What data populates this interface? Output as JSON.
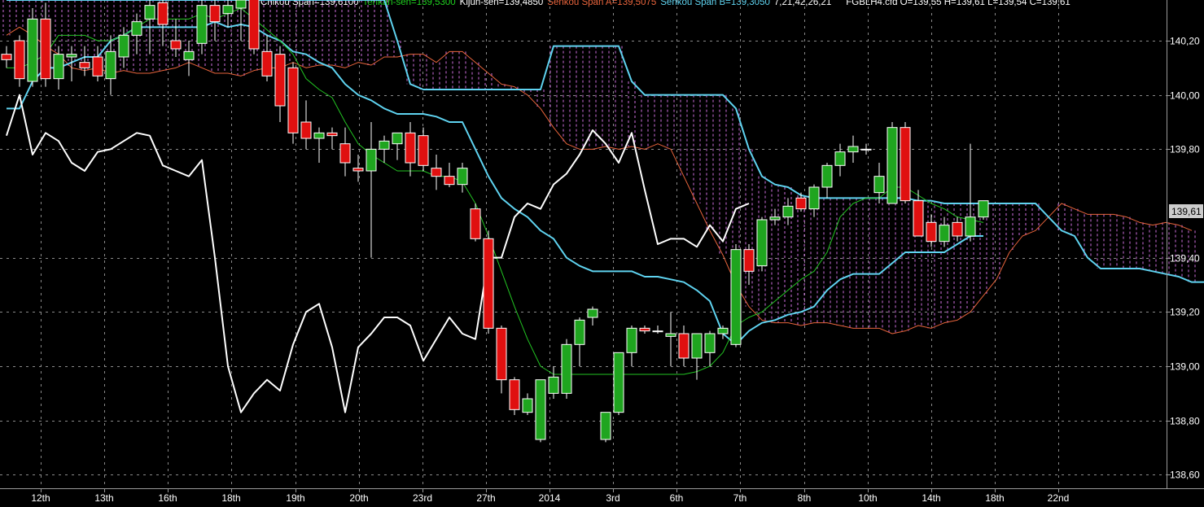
{
  "legend": {
    "chikou": "Chikou Span=139,6100",
    "tenkan": "Tenkan-sen=139,5300",
    "kijun": "Kijun-sen=139,4850",
    "senkou_a": "Senkou Span A=139,5075",
    "senkou_b": "Senkou Span B=139,3050",
    "params": "7,21,42,26,21",
    "instrument": "FGBLH4.cfd O=139,55 H=139,61 L=139,54 C=139,61"
  },
  "colors": {
    "background": "#000000",
    "grid": "#8a8a8a",
    "bull": "#1fa51f",
    "bear": "#e01010",
    "chikou": "#ffffff",
    "tenkan": "#22c422",
    "kijun": "#ffffff",
    "senkou_a": "#e8643c",
    "senkou_b": "#5fd3f0",
    "cloud_hatch": "#d070e0",
    "price_tag_bg": "#cccccc"
  },
  "price_tag": "139,61",
  "chart_data": {
    "type": "candlestick",
    "ylim": [
      138.55,
      140.35
    ],
    "y_ticks": [
      "140,20",
      "140,00",
      "139,80",
      "139,40",
      "139,20",
      "139,00",
      "138,80",
      "138,60"
    ],
    "x_labels": [
      "12th",
      "13th",
      "16th",
      "18th",
      "19th",
      "20th",
      "23rd",
      "27th",
      "2014",
      "3rd",
      "6th",
      "7th",
      "8th",
      "10th",
      "14th",
      "18th",
      "22nd"
    ],
    "candles": [
      {
        "o": 140.15,
        "h": 140.18,
        "l": 140.1,
        "c": 140.13
      },
      {
        "o": 140.2,
        "h": 140.22,
        "l": 140.03,
        "c": 140.06
      },
      {
        "o": 140.05,
        "h": 140.32,
        "l": 140.03,
        "c": 140.28
      },
      {
        "o": 140.28,
        "h": 140.34,
        "l": 140.03,
        "c": 140.06
      },
      {
        "o": 140.06,
        "h": 140.18,
        "l": 140.02,
        "c": 140.15
      },
      {
        "o": 140.14,
        "h": 140.18,
        "l": 140.05,
        "c": 140.15
      },
      {
        "o": 140.12,
        "h": 140.18,
        "l": 140.07,
        "c": 140.1
      },
      {
        "o": 140.14,
        "h": 140.18,
        "l": 140.05,
        "c": 140.07
      },
      {
        "o": 140.06,
        "h": 140.22,
        "l": 140.0,
        "c": 140.16
      },
      {
        "o": 140.14,
        "h": 140.25,
        "l": 140.1,
        "c": 140.22
      },
      {
        "o": 140.22,
        "h": 140.3,
        "l": 140.15,
        "c": 140.27
      },
      {
        "o": 140.28,
        "h": 140.38,
        "l": 140.15,
        "c": 140.33
      },
      {
        "o": 140.34,
        "h": 140.38,
        "l": 140.18,
        "c": 140.26
      },
      {
        "o": 140.2,
        "h": 140.28,
        "l": 140.14,
        "c": 140.17
      },
      {
        "o": 140.13,
        "h": 140.2,
        "l": 140.07,
        "c": 140.16
      },
      {
        "o": 140.19,
        "h": 140.35,
        "l": 140.15,
        "c": 140.33
      },
      {
        "o": 140.33,
        "h": 140.4,
        "l": 140.2,
        "c": 140.27
      },
      {
        "o": 140.3,
        "h": 140.36,
        "l": 140.25,
        "c": 140.33
      },
      {
        "o": 140.32,
        "h": 140.38,
        "l": 140.2,
        "c": 140.35
      },
      {
        "o": 140.36,
        "h": 140.4,
        "l": 140.15,
        "c": 140.17
      },
      {
        "o": 140.16,
        "h": 140.22,
        "l": 140.05,
        "c": 140.07
      },
      {
        "o": 140.15,
        "h": 140.18,
        "l": 139.9,
        "c": 139.96
      },
      {
        "o": 140.1,
        "h": 140.12,
        "l": 139.82,
        "c": 139.86
      },
      {
        "o": 139.9,
        "h": 139.98,
        "l": 139.8,
        "c": 139.84
      },
      {
        "o": 139.84,
        "h": 139.88,
        "l": 139.75,
        "c": 139.86
      },
      {
        "o": 139.86,
        "h": 139.88,
        "l": 139.8,
        "c": 139.85
      },
      {
        "o": 139.82,
        "h": 139.88,
        "l": 139.7,
        "c": 139.75
      },
      {
        "o": 139.73,
        "h": 139.78,
        "l": 139.68,
        "c": 139.72
      },
      {
        "o": 139.72,
        "h": 139.9,
        "l": 139.4,
        "c": 139.8
      },
      {
        "o": 139.8,
        "h": 139.85,
        "l": 139.75,
        "c": 139.83
      },
      {
        "o": 139.82,
        "h": 139.86,
        "l": 139.76,
        "c": 139.86
      },
      {
        "o": 139.86,
        "h": 139.9,
        "l": 139.7,
        "c": 139.75
      },
      {
        "o": 139.85,
        "h": 139.88,
        "l": 139.72,
        "c": 139.74
      },
      {
        "o": 139.73,
        "h": 139.78,
        "l": 139.65,
        "c": 139.7
      },
      {
        "o": 139.7,
        "h": 139.75,
        "l": 139.66,
        "c": 139.67
      },
      {
        "o": 139.67,
        "h": 139.75,
        "l": 139.64,
        "c": 139.73
      },
      {
        "o": 139.58,
        "h": 139.6,
        "l": 139.46,
        "c": 139.47
      },
      {
        "o": 139.47,
        "h": 139.5,
        "l": 139.12,
        "c": 139.14
      },
      {
        "o": 139.14,
        "h": 139.15,
        "l": 138.9,
        "c": 138.95
      },
      {
        "o": 138.95,
        "h": 138.96,
        "l": 138.82,
        "c": 138.84
      },
      {
        "o": 138.83,
        "h": 138.9,
        "l": 138.82,
        "c": 138.88
      },
      {
        "o": 138.73,
        "h": 138.95,
        "l": 138.72,
        "c": 138.95
      },
      {
        "o": 138.9,
        "h": 139.0,
        "l": 138.88,
        "c": 138.96
      },
      {
        "o": 138.9,
        "h": 139.1,
        "l": 138.88,
        "c": 139.08
      },
      {
        "o": 139.08,
        "h": 139.18,
        "l": 139.0,
        "c": 139.17
      },
      {
        "o": 139.18,
        "h": 139.22,
        "l": 139.15,
        "c": 139.21
      },
      {
        "o": 138.73,
        "h": 138.83,
        "l": 138.72,
        "c": 138.83
      },
      {
        "o": 138.83,
        "h": 139.05,
        "l": 138.82,
        "c": 139.05
      },
      {
        "o": 139.05,
        "h": 139.15,
        "l": 139.0,
        "c": 139.14
      },
      {
        "o": 139.14,
        "h": 139.15,
        "l": 139.12,
        "c": 139.13
      },
      {
        "o": 139.13,
        "h": 139.15,
        "l": 139.12,
        "c": 139.13
      },
      {
        "o": 139.11,
        "h": 139.2,
        "l": 139.0,
        "c": 139.12
      },
      {
        "o": 139.12,
        "h": 139.15,
        "l": 139.0,
        "c": 139.03
      },
      {
        "o": 139.03,
        "h": 139.12,
        "l": 138.95,
        "c": 139.12
      },
      {
        "o": 139.05,
        "h": 139.13,
        "l": 139.0,
        "c": 139.12
      },
      {
        "o": 139.12,
        "h": 139.15,
        "l": 139.1,
        "c": 139.14
      },
      {
        "o": 139.08,
        "h": 139.45,
        "l": 139.07,
        "c": 139.43
      },
      {
        "o": 139.43,
        "h": 139.45,
        "l": 139.3,
        "c": 139.35
      },
      {
        "o": 139.37,
        "h": 139.55,
        "l": 139.35,
        "c": 139.54
      },
      {
        "o": 139.54,
        "h": 139.58,
        "l": 139.52,
        "c": 139.55
      },
      {
        "o": 139.55,
        "h": 139.62,
        "l": 139.52,
        "c": 139.59
      },
      {
        "o": 139.62,
        "h": 139.64,
        "l": 139.57,
        "c": 139.58
      },
      {
        "o": 139.58,
        "h": 139.67,
        "l": 139.55,
        "c": 139.66
      },
      {
        "o": 139.66,
        "h": 139.75,
        "l": 139.62,
        "c": 139.74
      },
      {
        "o": 139.74,
        "h": 139.82,
        "l": 139.7,
        "c": 139.79
      },
      {
        "o": 139.79,
        "h": 139.85,
        "l": 139.75,
        "c": 139.81
      },
      {
        "o": 139.8,
        "h": 139.82,
        "l": 139.78,
        "c": 139.8
      },
      {
        "o": 139.64,
        "h": 139.75,
        "l": 139.6,
        "c": 139.7
      },
      {
        "o": 139.6,
        "h": 139.9,
        "l": 139.6,
        "c": 139.88
      },
      {
        "o": 139.88,
        "h": 139.9,
        "l": 139.6,
        "c": 139.61
      },
      {
        "o": 139.61,
        "h": 139.65,
        "l": 139.48,
        "c": 139.48
      },
      {
        "o": 139.53,
        "h": 139.56,
        "l": 139.44,
        "c": 139.46
      },
      {
        "o": 139.46,
        "h": 139.55,
        "l": 139.44,
        "c": 139.52
      },
      {
        "o": 139.53,
        "h": 139.55,
        "l": 139.46,
        "c": 139.48
      },
      {
        "o": 139.48,
        "h": 139.82,
        "l": 139.46,
        "c": 139.55
      },
      {
        "o": 139.55,
        "h": 139.61,
        "l": 139.54,
        "c": 139.61
      }
    ],
    "series": [
      {
        "name": "Chikou Span",
        "values": [
          139.85,
          140.0,
          139.78,
          139.86,
          139.83,
          139.75,
          139.72,
          139.79,
          139.8,
          139.83,
          139.86,
          139.85,
          139.74,
          139.72,
          139.7,
          139.76,
          139.4,
          139.0,
          138.83,
          138.9,
          138.95,
          138.91,
          139.08,
          139.2,
          139.23,
          139.07,
          138.83,
          139.07,
          139.12,
          139.18,
          139.18,
          139.15,
          139.02,
          139.1,
          139.18,
          139.12,
          139.1,
          139.4,
          139.4,
          139.55,
          139.6,
          139.58,
          139.67,
          139.71,
          139.78,
          139.87,
          139.82,
          139.75,
          139.86,
          139.65,
          139.45,
          139.47,
          139.47,
          139.44,
          139.52,
          139.46,
          139.58,
          139.6
        ]
      },
      {
        "name": "Tenkan-sen",
        "values": [
          140.1,
          140.1,
          140.12,
          140.15,
          140.22,
          140.22,
          140.22,
          140.2,
          140.2,
          140.22,
          140.25,
          140.28,
          140.28,
          140.28,
          140.28,
          140.3,
          140.28,
          140.3,
          140.32,
          140.28,
          140.24,
          140.2,
          140.15,
          140.06,
          140.02,
          139.99,
          139.9,
          139.82,
          139.78,
          139.75,
          139.72,
          139.72,
          139.72,
          139.7,
          139.7,
          139.68,
          139.6,
          139.48,
          139.35,
          139.22,
          139.1,
          139.0,
          138.97,
          138.97,
          138.97,
          138.97,
          138.97,
          138.97,
          138.97,
          138.97,
          138.97,
          138.97,
          138.97,
          138.98,
          139.0,
          139.05,
          139.15,
          139.18,
          139.2,
          139.24,
          139.28,
          139.32,
          139.35,
          139.42,
          139.55,
          139.6,
          139.62,
          139.62,
          139.66,
          139.66,
          139.63,
          139.6,
          139.58,
          139.55,
          139.54,
          139.53
        ]
      },
      {
        "name": "Kijun-sen",
        "values": [
          139.95,
          139.95,
          140.05,
          140.1,
          140.1,
          140.12,
          140.14,
          140.14,
          140.2,
          140.22,
          140.25,
          140.25,
          140.25,
          140.25,
          140.25,
          140.25,
          140.27,
          140.25,
          140.26,
          140.25,
          140.22,
          140.2,
          140.16,
          140.15,
          140.12,
          140.1,
          140.04,
          140.0,
          139.98,
          139.95,
          139.93,
          139.93,
          139.93,
          139.92,
          139.9,
          139.9,
          139.8,
          139.7,
          139.62,
          139.58,
          139.55,
          139.5,
          139.47,
          139.4,
          139.37,
          139.35,
          139.35,
          139.35,
          139.35,
          139.33,
          139.33,
          139.32,
          139.31,
          139.28,
          139.24,
          139.12,
          139.08,
          139.13,
          139.16,
          139.17,
          139.19,
          139.2,
          139.22,
          139.28,
          139.32,
          139.34,
          139.34,
          139.34,
          139.38,
          139.42,
          139.42,
          139.42,
          139.42,
          139.45,
          139.48,
          139.48
        ]
      },
      {
        "name": "Senkou Span A",
        "values": [
          140.22,
          140.25,
          140.22,
          140.18,
          140.15,
          140.1,
          140.09,
          140.1,
          140.08,
          140.09,
          140.08,
          140.08,
          140.09,
          140.1,
          140.12,
          140.1,
          140.08,
          140.08,
          140.07,
          140.09,
          140.1,
          140.1,
          140.12,
          140.1,
          140.11,
          140.11,
          140.1,
          140.12,
          140.11,
          140.14,
          140.14,
          140.15,
          140.15,
          140.12,
          140.16,
          140.16,
          140.12,
          140.08,
          140.04,
          140.03,
          140.0,
          139.95,
          139.88,
          139.82,
          139.8,
          139.8,
          139.81,
          139.8,
          139.81,
          139.8,
          139.82,
          139.8,
          139.7,
          139.6,
          139.5,
          139.41,
          139.3,
          139.22,
          139.17,
          139.16,
          139.16,
          139.15,
          139.16,
          139.16,
          139.15,
          139.14,
          139.14,
          139.14,
          139.12,
          139.13,
          139.15,
          139.14,
          139.16,
          139.17,
          139.2,
          139.26,
          139.32,
          139.42,
          139.48,
          139.5,
          139.55,
          139.6,
          139.58,
          139.56,
          139.56,
          139.56,
          139.55,
          139.53,
          139.52,
          139.53,
          139.52,
          139.5
        ]
      },
      {
        "name": "Senkou Span B",
        "values": [
          140.35,
          140.35,
          140.35,
          140.35,
          140.35,
          140.35,
          140.35,
          140.35,
          140.35,
          140.35,
          140.35,
          140.35,
          140.35,
          140.35,
          140.35,
          140.35,
          140.35,
          140.35,
          140.35,
          140.35,
          140.35,
          140.35,
          140.35,
          140.35,
          140.35,
          140.35,
          140.35,
          140.35,
          140.35,
          140.35,
          140.2,
          140.04,
          140.02,
          140.02,
          140.02,
          140.02,
          140.02,
          140.02,
          140.02,
          140.02,
          140.02,
          140.02,
          140.18,
          140.18,
          140.18,
          140.18,
          140.18,
          140.18,
          140.05,
          140.0,
          140.0,
          140.0,
          140.0,
          140.0,
          140.0,
          140.0,
          139.95,
          139.8,
          139.7,
          139.67,
          139.66,
          139.63,
          139.62,
          139.62,
          139.62,
          139.62,
          139.62,
          139.62,
          139.62,
          139.62,
          139.61,
          139.61,
          139.6,
          139.6,
          139.6,
          139.6,
          139.6,
          139.6,
          139.6,
          139.6,
          139.55,
          139.5,
          139.48,
          139.4,
          139.36,
          139.36,
          139.36,
          139.36,
          139.35,
          139.34,
          139.33,
          139.31,
          139.31,
          139.31,
          139.31,
          139.31
        ]
      }
    ]
  }
}
